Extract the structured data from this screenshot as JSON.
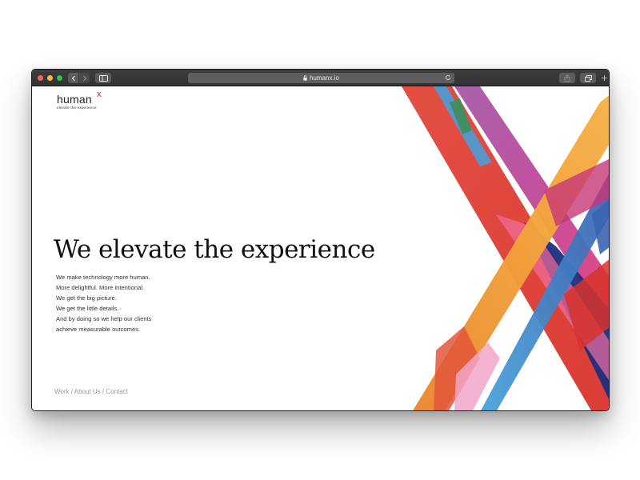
{
  "browser": {
    "url": "humanx.io",
    "traffic_lights": {
      "close": "#fe5f57",
      "minimize": "#febc2e",
      "zoom": "#28c840"
    },
    "icons": [
      "back-icon",
      "forward-icon",
      "sidebar-icon",
      "lock-icon",
      "reload-icon",
      "share-icon",
      "tabs-icon",
      "new-tab-icon"
    ]
  },
  "brand": {
    "word": "human",
    "mark": "x",
    "tagline": "elevate the experience",
    "accent": "#c2185b"
  },
  "hero": {
    "headline": "We elevate the experience",
    "lines": [
      "We make technology more human.",
      "More delightful. More intentional.",
      "We get the big picture.",
      "We get the little details.",
      "And by doing so we help our clients",
      "achieve measurable outcomes."
    ]
  },
  "footer": {
    "links": [
      "Work",
      "About Us",
      "Contact"
    ],
    "separator": " / "
  },
  "artwork": {
    "colors": [
      "#f0a13a",
      "#e23b2e",
      "#3f6db5",
      "#b84aa0",
      "#ef6ea0",
      "#1d2f80",
      "#4a9fd6"
    ]
  }
}
